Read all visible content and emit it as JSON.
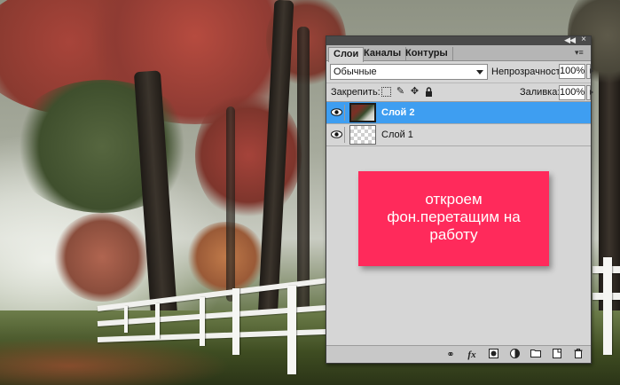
{
  "panel": {
    "tabs": [
      {
        "label": "Слои",
        "active": true
      },
      {
        "label": "Каналы",
        "active": false
      },
      {
        "label": "Контуры",
        "active": false
      }
    ],
    "blend_mode": "Обычные",
    "opacity_label": "Непрозрачность:",
    "opacity_value": "100%",
    "lock_label": "Закрепить:",
    "fill_label": "Заливка:",
    "fill_value": "100%",
    "layers": [
      {
        "name": "Слой 2",
        "selected": true,
        "thumbnail": "photo"
      },
      {
        "name": "Слой 1",
        "selected": false,
        "thumbnail": "transparent"
      }
    ]
  },
  "annotation": {
    "text": "откроем фон.перетащим на работу",
    "color": "#ff2a5b"
  },
  "colors": {
    "selection": "#3e9ef1",
    "panel_bg": "#d6d6d6"
  },
  "icons": {
    "lock_buttons": [
      "lock-transparency-icon",
      "lock-pixels-icon",
      "lock-position-icon",
      "lock-all-icon"
    ],
    "bottom_buttons": [
      "link-layers-icon",
      "fx-icon",
      "layer-mask-icon",
      "adjustment-layer-icon",
      "new-group-icon",
      "new-layer-icon",
      "trash-icon"
    ]
  }
}
